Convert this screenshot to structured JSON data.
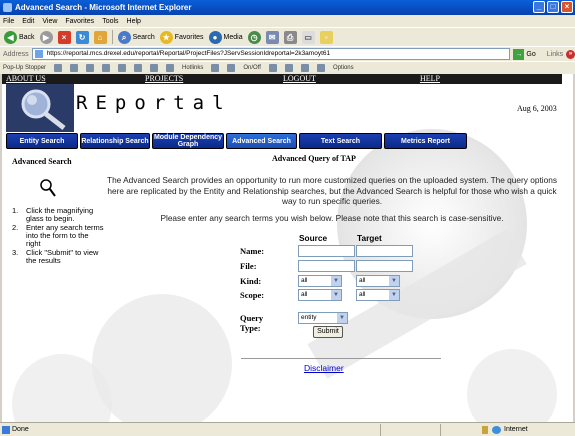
{
  "window": {
    "title": "Advanced Search - Microsoft Internet Explorer"
  },
  "menu": [
    "File",
    "Edit",
    "View",
    "Favorites",
    "Tools",
    "Help"
  ],
  "toolbar": {
    "back": "Back",
    "search": "Search",
    "favorites": "Favorites",
    "media": "Media"
  },
  "address": {
    "label": "Address",
    "url": "https://reportal.mcs.drexel.edu/reportal/Reportal/ProjectFiles?JServSessionIdreportal=2k3amoyt61",
    "go": "Go",
    "links": "Links"
  },
  "popup": {
    "label": "Pop-Up Stopper",
    "hotlinks": "Hotlinks",
    "onoff": "On/Off",
    "options": "Options"
  },
  "nav": {
    "about": "ABOUT US",
    "projects": "PROJECTS",
    "logout": "LOGOUT",
    "help": "HELP"
  },
  "banner": {
    "logo": "REportal",
    "date": "Aug 6, 2003"
  },
  "tabs": [
    "Entity Search",
    "Relationship Search",
    "Module Dependency Graph",
    "Advanced Search",
    "Text Search",
    "Metrics Report"
  ],
  "active_tab": "Advanced Search",
  "sidebar": {
    "title": "Advanced Search",
    "steps": [
      {
        "num": "1.",
        "text": "Click the magnifying glass to begin."
      },
      {
        "num": "2.",
        "text": "Enter any search terms into the form to the right"
      },
      {
        "num": "3.",
        "text": "Click \"Submit\" to view the results"
      }
    ]
  },
  "main": {
    "title": "Advanced Query of TAP",
    "intro": "The Advanced Search provides an opportunity to run more customized queries on the uploaded system. The query options here are replicated by the Entity and Relationship searches, but the Advanced Search is helpful for those who wish a quick way to run specific queries.",
    "note": "Please enter any search terms you wish below. Please note that this search is case-sensitive."
  },
  "form": {
    "source_header": "Source",
    "target_header": "Target",
    "name_label": "Name:",
    "file_label": "File:",
    "kind_label": "Kind:",
    "scope_label": "Scope:",
    "kind_source": "all",
    "kind_target": "all",
    "scope_source": "all",
    "scope_target": "all",
    "query_type_label": "Query Type:",
    "query_type": "entity",
    "submit": "Submit"
  },
  "footer": {
    "disclaimer": "Disclaimer"
  },
  "status": {
    "text": "Done",
    "zone": "Internet"
  }
}
